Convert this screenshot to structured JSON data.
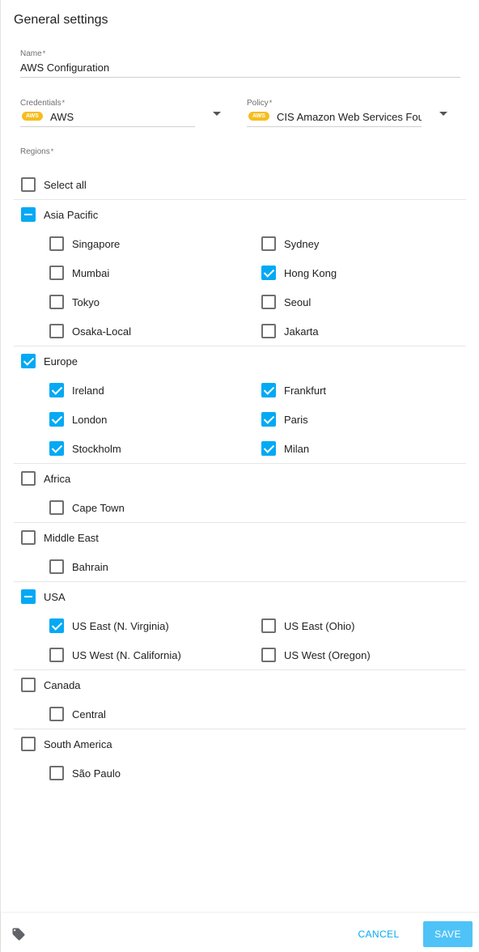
{
  "section_title": "General settings",
  "name_field": {
    "label": "Name",
    "required_mark": "*",
    "value": "AWS Configuration"
  },
  "credentials_field": {
    "label": "Credentials",
    "required_mark": "*",
    "badge": "AWS",
    "value": "AWS"
  },
  "policy_field": {
    "label": "Policy",
    "required_mark": "*",
    "badge": "AWS",
    "value": "CIS Amazon Web Services Fou"
  },
  "regions_label": "Regions",
  "regions_required_mark": "*",
  "select_all": {
    "label": "Select all",
    "state": "unchecked"
  },
  "groups": [
    {
      "label": "Asia Pacific",
      "state": "indeterminate",
      "regions": [
        {
          "label": "Singapore",
          "checked": false
        },
        {
          "label": "Sydney",
          "checked": false
        },
        {
          "label": "Mumbai",
          "checked": false
        },
        {
          "label": "Hong Kong",
          "checked": true
        },
        {
          "label": "Tokyo",
          "checked": false
        },
        {
          "label": "Seoul",
          "checked": false
        },
        {
          "label": "Osaka-Local",
          "checked": false
        },
        {
          "label": "Jakarta",
          "checked": false
        }
      ]
    },
    {
      "label": "Europe",
      "state": "checked",
      "regions": [
        {
          "label": "Ireland",
          "checked": true
        },
        {
          "label": "Frankfurt",
          "checked": true
        },
        {
          "label": "London",
          "checked": true
        },
        {
          "label": "Paris",
          "checked": true
        },
        {
          "label": "Stockholm",
          "checked": true
        },
        {
          "label": "Milan",
          "checked": true
        }
      ]
    },
    {
      "label": "Africa",
      "state": "unchecked",
      "regions": [
        {
          "label": "Cape Town",
          "checked": false
        }
      ]
    },
    {
      "label": "Middle East",
      "state": "unchecked",
      "regions": [
        {
          "label": "Bahrain",
          "checked": false
        }
      ]
    },
    {
      "label": "USA",
      "state": "indeterminate",
      "regions": [
        {
          "label": "US East (N. Virginia)",
          "checked": true
        },
        {
          "label": "US East (Ohio)",
          "checked": false
        },
        {
          "label": "US West (N. California)",
          "checked": false
        },
        {
          "label": "US West (Oregon)",
          "checked": false
        }
      ]
    },
    {
      "label": "Canada",
      "state": "unchecked",
      "regions": [
        {
          "label": "Central",
          "checked": false
        }
      ]
    },
    {
      "label": "South America",
      "state": "unchecked",
      "regions": [
        {
          "label": "São Paulo",
          "checked": false
        }
      ]
    }
  ],
  "footer": {
    "tag_icon": "tag-icon",
    "cancel_label": "CANCEL",
    "save_label": "SAVE"
  },
  "colors": {
    "accent": "#03a9f4",
    "save_button": "#4fc3f7",
    "aws_badge": "#f6bd1f"
  }
}
